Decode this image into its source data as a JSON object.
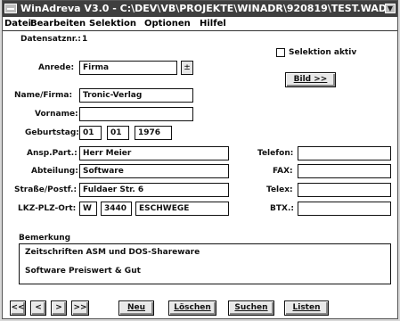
{
  "window": {
    "title": "WinAdreva V3.0 - C:\\DEV\\VB\\PROJEKTE\\WINADR\\920819\\TEST.WAD"
  },
  "menu": [
    "Datei",
    "Bearbeiten",
    "Selektion",
    "Optionen",
    "Hilfel"
  ],
  "form": {
    "datensatz_label": "Datensatznr.:",
    "datensatz_value": "1",
    "selektion_label": "Selektion aktiv",
    "bild_button": "Bild >>",
    "anrede_label": "Anrede:",
    "anrede_value": "Firma",
    "dropdown_arrow": "±",
    "name_label": "Name/Firma:",
    "name_value": "Tronic-Verlag",
    "vorname_label": "Vorname:",
    "vorname_value": "",
    "geburtstag_label": "Geburtstag:",
    "geburtstag_day": "01",
    "geburtstag_month": "01",
    "geburtstag_year": "1976",
    "ansp_label": "Ansp.Part.:",
    "ansp_value": "Herr Meier",
    "abteilung_label": "Abteilung:",
    "abteilung_value": "Software",
    "strasse_label": "Straße/Postf.:",
    "strasse_value": "Fuldaer Str. 6",
    "lkz_label": "LKZ-PLZ-Ort:",
    "lkz_value": "W",
    "plz_value": "3440",
    "ort_value": "ESCHWEGE",
    "telefon_label": "Telefon:",
    "telefon_value": "",
    "fax_label": "FAX:",
    "fax_value": "",
    "telex_label": "Telex:",
    "telex_value": "",
    "btx_label": "BTX.:",
    "btx_value": ""
  },
  "bemerkung": {
    "label": "Bemerkung",
    "lines": [
      "Zeitschriften ASM und DOS-Shareware",
      "Software Preiswert & Gut"
    ]
  },
  "buttons": {
    "first": "<<",
    "prev": "<",
    "next": ">",
    "last": ">>",
    "neu": "Neu",
    "loeschen": "Löschen",
    "suchen": "Suchen",
    "listen": "Listen"
  }
}
